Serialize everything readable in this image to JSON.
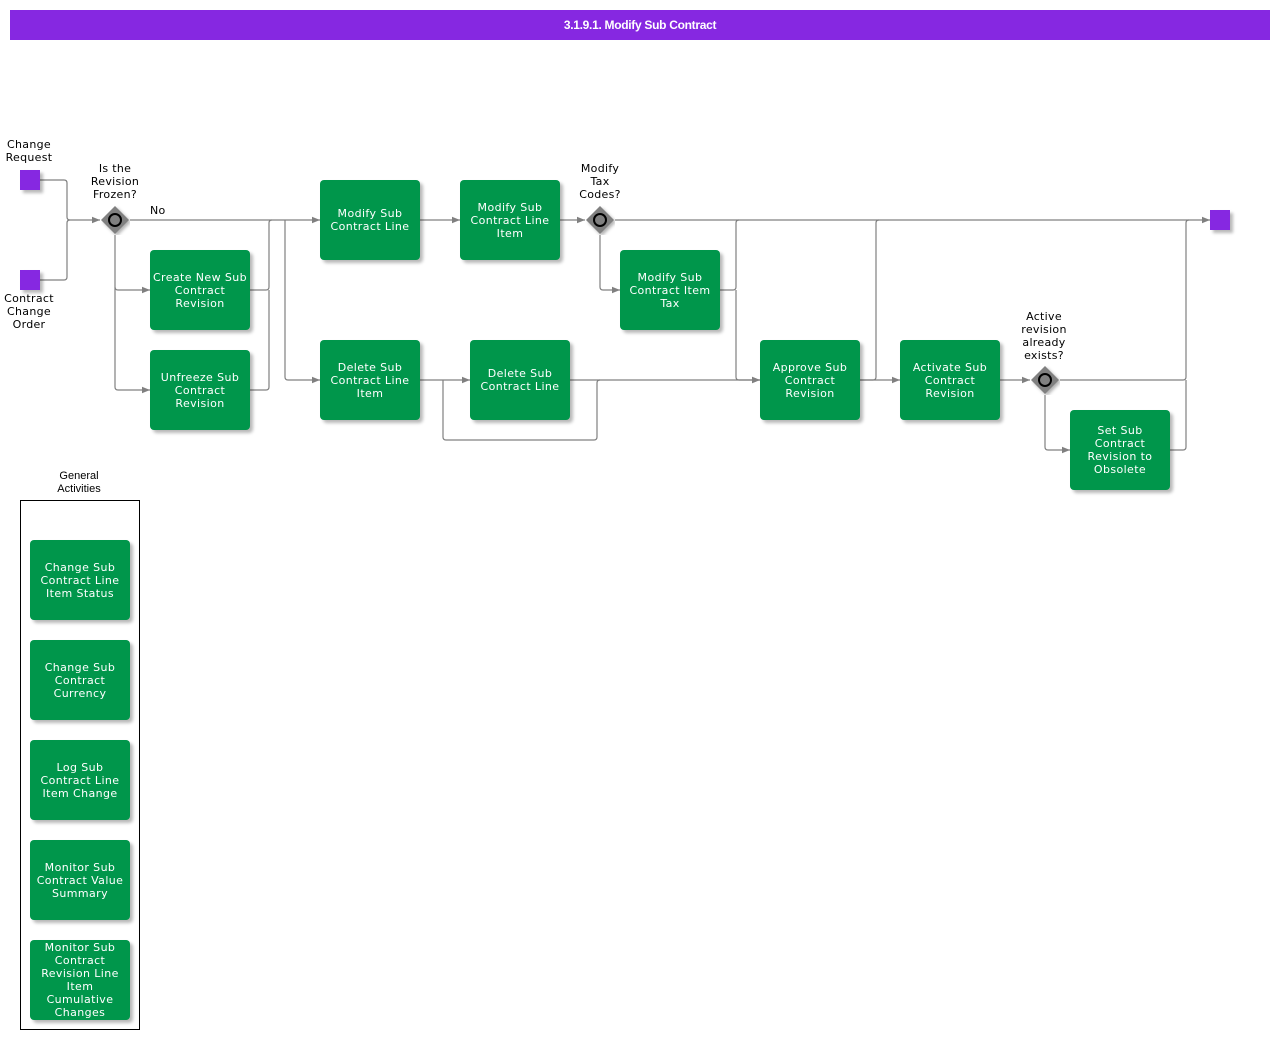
{
  "title": "3.1.9.1. Modify Sub Contract",
  "colors": {
    "title_bar": "#8628e1",
    "event": "#8628e1",
    "task": "#00964b",
    "gateway": "#808080",
    "connector": "#808080"
  },
  "start_events": [
    {
      "label": "Change\nRequest"
    },
    {
      "label": "Contract\nChange\nOrder"
    }
  ],
  "end_event": {
    "label": ""
  },
  "gateways": [
    {
      "label": "Is the\nRevision\nFrozen?",
      "outgoing_label": "No"
    },
    {
      "label": "Modify\nTax\nCodes?"
    },
    {
      "label": "Active\nrevision\nalready\nexists?"
    }
  ],
  "tasks": {
    "create_new_revision": "Create New Sub Contract Revision",
    "unfreeze_revision": "Unfreeze Sub Contract Revision",
    "modify_line": "Modify Sub Contract Line",
    "modify_line_item": "Modify Sub Contract Line Item",
    "modify_item_tax": "Modify Sub Contract Item Tax",
    "delete_line_item": "Delete Sub Contract Line Item",
    "delete_line": "Delete Sub Contract Line",
    "approve_revision": "Approve Sub Contract Revision",
    "activate_revision": "Activate Sub Contract Revision",
    "set_obsolete": "Set Sub Contract Revision to Obsolete"
  },
  "general_activities": {
    "label": "General\nActivities",
    "items": [
      "Change Sub Contract Line Item Status",
      "Change Sub Contract Currency",
      "Log Sub Contract Line Item Change",
      "Monitor Sub Contract Value Summary",
      "Monitor Sub Contract Revision Line Item Cumulative Changes"
    ]
  }
}
